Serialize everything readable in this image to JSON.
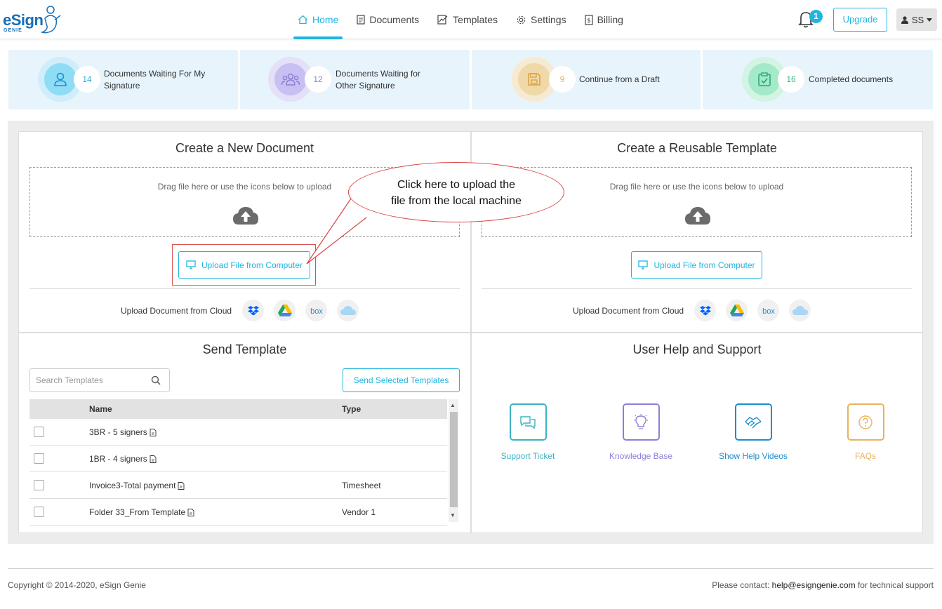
{
  "brand": {
    "logo_text": "eSign",
    "logo_sub": "GENIE"
  },
  "nav": [
    {
      "label": "Home",
      "icon": "home-icon",
      "active": true
    },
    {
      "label": "Documents",
      "icon": "document-icon"
    },
    {
      "label": "Templates",
      "icon": "templates-icon"
    },
    {
      "label": "Settings",
      "icon": "gear-icon"
    },
    {
      "label": "Billing",
      "icon": "billing-icon"
    }
  ],
  "header": {
    "notification_count": "1",
    "upgrade_label": "Upgrade",
    "user_initials": "SS"
  },
  "stats": [
    {
      "count": "14",
      "label_line1": "Documents Waiting For My",
      "label_line2": "Signature",
      "color": "#2eaee6"
    },
    {
      "count": "12",
      "label_line1": "Documents Waiting for",
      "label_line2": "Other Signature",
      "color": "#8c7fd9"
    },
    {
      "count": "9",
      "label": "Continue from a Draft",
      "color": "#e8b35a"
    },
    {
      "count": "16",
      "label": "Completed documents",
      "color": "#2fc08a"
    }
  ],
  "create_document": {
    "title": "Create a New Document",
    "drop_text": "Drag file here or use the icons below to upload",
    "upload_label": "Upload File from Computer",
    "cloud_label": "Upload Document from Cloud"
  },
  "create_template": {
    "title": "Create a Reusable Template",
    "drop_text": "Drag file here or use the icons below to upload",
    "upload_label": "Upload File from Computer",
    "cloud_label": "Upload Document from Cloud"
  },
  "callout": {
    "line1": "Click here to upload the",
    "line2": "file from the local machine"
  },
  "send_template": {
    "title": "Send Template",
    "search_placeholder": "Search Templates",
    "send_label": "Send Selected Templates",
    "columns": {
      "name": "Name",
      "type": "Type"
    },
    "rows": [
      {
        "name": "3BR - 5 signers",
        "type": ""
      },
      {
        "name": "1BR - 4 signers",
        "type": ""
      },
      {
        "name": "Invoice3-Total payment",
        "type": "Timesheet"
      },
      {
        "name": "Folder 33_From Template",
        "type": "Vendor 1"
      }
    ]
  },
  "help": {
    "title": "User Help and Support",
    "items": [
      {
        "label": "Support Ticket",
        "color": "#3bb3c3"
      },
      {
        "label": "Knowledge Base",
        "color": "#8c7fd9"
      },
      {
        "label": "Show Help Videos",
        "color": "#1a8fcf"
      },
      {
        "label": "FAQs",
        "color": "#e8b35a"
      }
    ]
  },
  "footer": {
    "copyright": "Copyright © 2014-2020, eSign Genie",
    "contact_prefix": "Please contact:",
    "email": "help@esigngenie.com",
    "contact_suffix": "for technical support"
  }
}
